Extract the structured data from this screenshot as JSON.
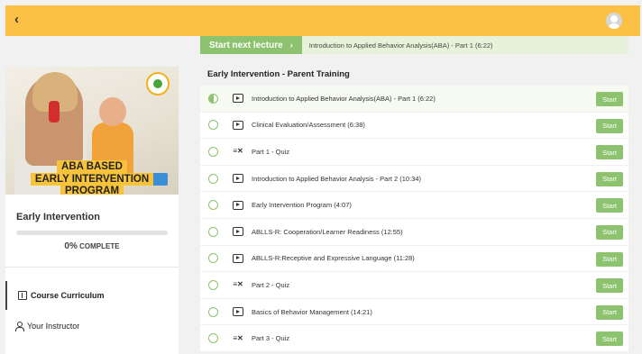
{
  "header": {
    "back_icon": "chevron-left-icon",
    "back_label": "‹",
    "avatar_icon": "user-avatar-icon",
    "background_color": "#fbc146"
  },
  "sidebar": {
    "banner_line1": "ABA BASED",
    "banner_line2": "EARLY INTERVENTION",
    "banner_line3": "PROGRAM",
    "course_title": "Early Intervention",
    "progress_value": 0,
    "progress_percent": "0%",
    "progress_label": "COMPLETE",
    "nav": [
      {
        "label": "Course Curriculum",
        "icon": "book-icon",
        "active": true
      },
      {
        "label": "Your Instructor",
        "icon": "user-icon",
        "active": false
      }
    ]
  },
  "next_lecture": {
    "button_label": "Start next lecture",
    "arrow": "›",
    "title": "Introduction to Applied Behavior Analysis(ABA) - Part 1 (6:22)"
  },
  "section": {
    "title": "Early Intervention - Parent Training",
    "lectures": [
      {
        "title": "Introduction to Applied Behavior Analysis(ABA) - Part 1 (6:22)",
        "type": "video",
        "status": "in-progress",
        "button": "Start"
      },
      {
        "title": "Clinical Evaluation/Assessment (6:38)",
        "type": "video",
        "status": "not-started",
        "button": "Start"
      },
      {
        "title": "Part 1 - Quiz",
        "type": "quiz",
        "status": "not-started",
        "button": "Start"
      },
      {
        "title": "Introduction to Applied Behavior Analysis - Part 2 (10:34)",
        "type": "video",
        "status": "not-started",
        "button": "Start"
      },
      {
        "title": "Early Intervention Program (4:07)",
        "type": "video",
        "status": "not-started",
        "button": "Start"
      },
      {
        "title": "ABLLS-R: Cooperation/Learner Readiness (12:55)",
        "type": "video",
        "status": "not-started",
        "button": "Start"
      },
      {
        "title": "ABLLS-R:Receptive and Expressive Language (11:28)",
        "type": "video",
        "status": "not-started",
        "button": "Start"
      },
      {
        "title": "Part 2 - Quiz",
        "type": "quiz",
        "status": "not-started",
        "button": "Start"
      },
      {
        "title": "Basics of Behavior Management (14:21)",
        "type": "video",
        "status": "not-started",
        "button": "Start"
      },
      {
        "title": "Part 3 - Quiz",
        "type": "quiz",
        "status": "not-started",
        "button": "Start"
      }
    ]
  },
  "colors": {
    "accent_green": "#8dc26f",
    "header_yellow": "#fbc146",
    "banner_yellow": "#f7c33a"
  }
}
